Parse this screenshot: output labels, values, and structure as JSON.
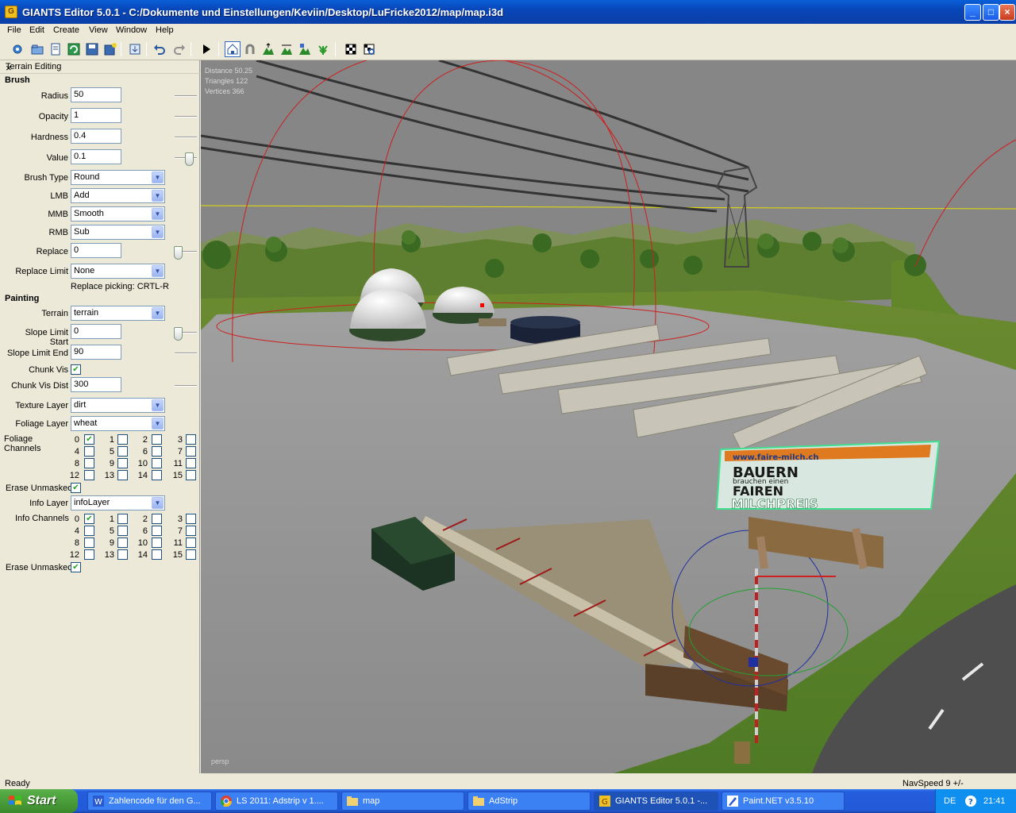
{
  "window": {
    "title": "GIANTS Editor 5.0.1 - C:/Dokumente und Einstellungen/Keviin/Desktop/LuFricke2012/map/map.i3d",
    "min_label": "_",
    "max_label": "□",
    "close_label": "×"
  },
  "menu": [
    "File",
    "Edit",
    "Create",
    "View",
    "Window",
    "Help"
  ],
  "panel": {
    "title": "Terrain Editing",
    "close_label": "×",
    "brush": {
      "heading": "Brush",
      "radius_label": "Radius",
      "radius": "50",
      "opacity_label": "Opacity",
      "opacity": "1",
      "hardness_label": "Hardness",
      "hardness": "0.4",
      "value_label": "Value",
      "value": "0.1",
      "brush_type_label": "Brush Type",
      "brush_type": "Round",
      "lmb_label": "LMB",
      "lmb": "Add",
      "mmb_label": "MMB",
      "mmb": "Smooth",
      "rmb_label": "RMB",
      "rmb": "Sub",
      "replace_label": "Replace",
      "replace": "0",
      "replace_limit_label": "Replace Limit",
      "replace_limit": "None",
      "replace_picking": "Replace picking: CRTL-R"
    },
    "painting": {
      "heading": "Painting",
      "terrain_label": "Terrain",
      "terrain": "terrain",
      "slope_start_label": "Slope Limit Start",
      "slope_start": "0",
      "slope_end_label": "Slope Limit End",
      "slope_end": "90",
      "chunk_vis_label": "Chunk Vis",
      "chunk_vis_dist_label": "Chunk Vis Dist",
      "chunk_vis_dist": "300",
      "texture_layer_label": "Texture Layer",
      "texture_layer": "dirt",
      "foliage_layer_label": "Foliage Layer",
      "foliage_layer": "wheat",
      "foliage_channels_label": "Foliage Channels",
      "erase_unmasked_label": "Erase Unmasked",
      "info_layer_label": "Info Layer",
      "info_layer": "infoLayer",
      "info_channels_label": "Info Channels",
      "erase_unmasked2_label": "Erase Unmasked"
    },
    "channel_numbers": [
      "0",
      "1",
      "2",
      "3",
      "4",
      "5",
      "6",
      "7",
      "8",
      "9",
      "10",
      "11",
      "12",
      "13",
      "14",
      "15"
    ]
  },
  "viewport": {
    "stats": [
      "Distance 50.25",
      "Triangles 122",
      "Vertices 366"
    ],
    "camera": "persp",
    "sign_line1": "www.faire-milch.ch",
    "sign_line2": "BAUERN",
    "sign_line3": "brauchen einen",
    "sign_line4": "FAIREN",
    "sign_line5": "MILCHPREIS"
  },
  "status": {
    "left": "Ready",
    "right": "NavSpeed 9 +/-"
  },
  "taskbar": {
    "start": "Start",
    "tasks": [
      "Zahlencode für den G...",
      "LS 2011: Adstrip v 1....",
      "map",
      "AdStrip",
      "GIANTS Editor 5.0.1 -...",
      "Paint.NET v3.5.10"
    ],
    "lang": "DE",
    "time": "21:41"
  }
}
